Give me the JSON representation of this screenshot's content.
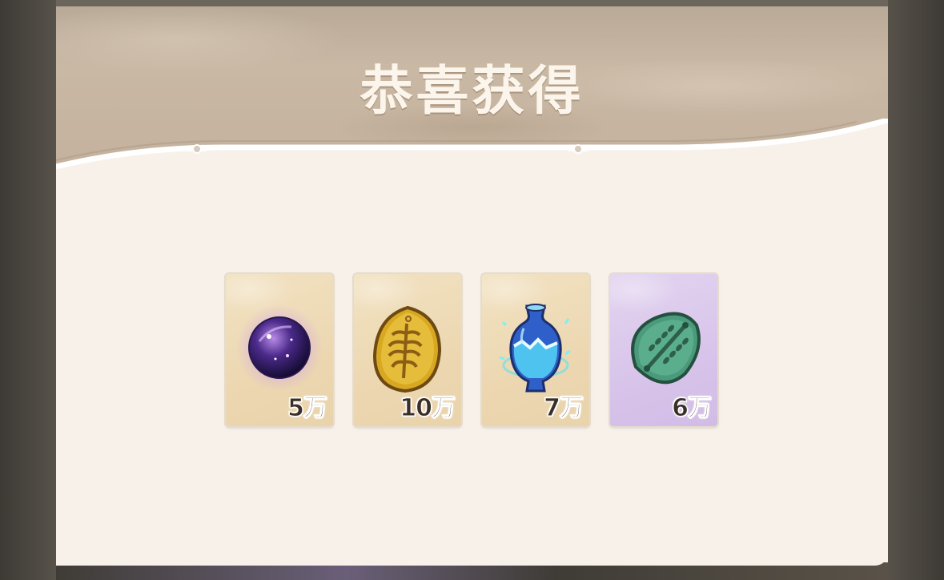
{
  "title": "恭喜获得",
  "rewards": [
    {
      "icon": "purple-orb-icon",
      "amount": "5万",
      "rarity": "gold"
    },
    {
      "icon": "golden-leaf-token-icon",
      "amount": "10万",
      "rarity": "gold"
    },
    {
      "icon": "blue-potion-vase-icon",
      "amount": "7万",
      "rarity": "gold"
    },
    {
      "icon": "jade-stone-token-icon",
      "amount": "6万",
      "rarity": "purple"
    }
  ],
  "colors": {
    "panel": "#f7f1ea",
    "header": "#c3b19d",
    "gold_card": "#ecd7b1",
    "purple_card": "#d8c4ea",
    "amount_text": "#3a2f27"
  }
}
